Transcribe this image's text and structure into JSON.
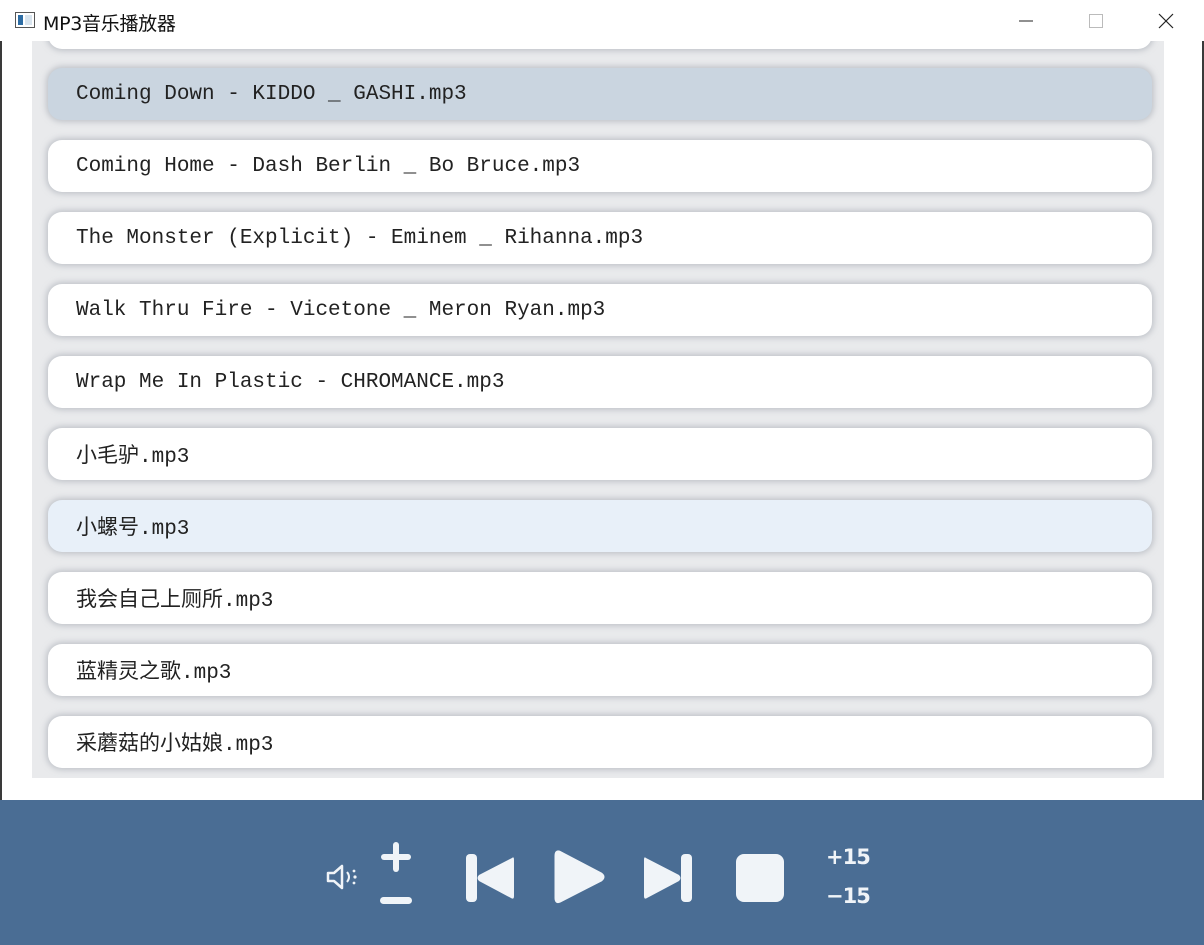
{
  "window": {
    "title": "MP3音乐播放器"
  },
  "playlist": {
    "items": [
      {
        "name": "Coming Down - KIDDO _ GASHI.mp3",
        "state": "selected"
      },
      {
        "name": "Coming Home - Dash Berlin _ Bo Bruce.mp3",
        "state": "normal"
      },
      {
        "name": "The Monster (Explicit) - Eminem _ Rihanna.mp3",
        "state": "normal"
      },
      {
        "name": "Walk Thru Fire - Vicetone _ Meron Ryan.mp3",
        "state": "normal"
      },
      {
        "name": "Wrap Me In Plastic - CHROMANCE.mp3",
        "state": "normal"
      },
      {
        "name": "小毛驴.mp3",
        "state": "normal"
      },
      {
        "name": "小螺号.mp3",
        "state": "hover"
      },
      {
        "name": "我会自己上厕所.mp3",
        "state": "normal"
      },
      {
        "name": "蓝精灵之歌.mp3",
        "state": "normal"
      },
      {
        "name": "采蘑菇的小姑娘.mp3",
        "state": "normal"
      }
    ]
  },
  "controls": {
    "volume_icon": "speaker-icon",
    "forward_label": "+15",
    "backward_label": "−15"
  },
  "colors": {
    "control_bar": "#4a6d94",
    "selected_item": "#cad5e0",
    "hover_item": "#e8f0f9",
    "list_background": "#e9eaec"
  }
}
